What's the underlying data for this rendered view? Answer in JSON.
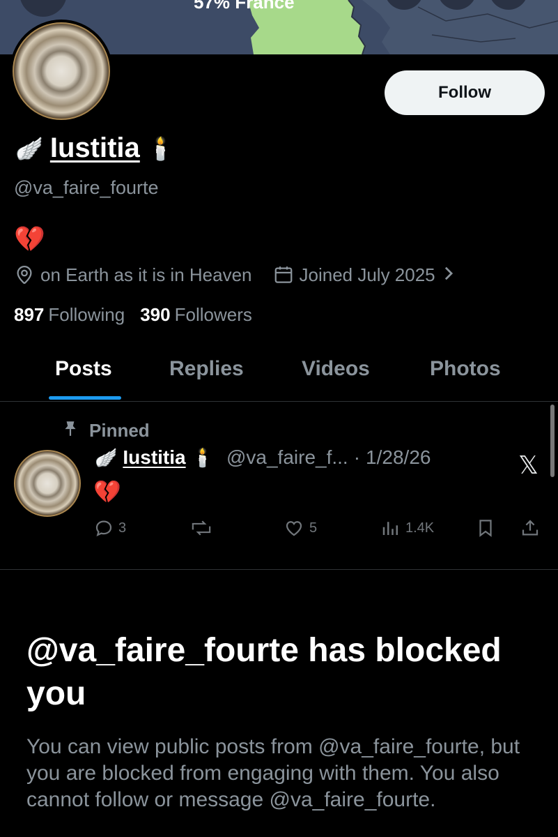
{
  "banner": {
    "text": "57% France"
  },
  "profile": {
    "follow_label": "Follow",
    "name": "Iustitia",
    "name_prefix_emoji": "🪽",
    "name_suffix_emoji": "🕯️",
    "handle": "@va_faire_fourte",
    "bio": "💔",
    "location": "on Earth as it is in Heaven",
    "joined": "Joined July 2025",
    "following_count": "897",
    "following_label": "Following",
    "followers_count": "390",
    "followers_label": "Followers"
  },
  "tabs": [
    {
      "label": "Posts",
      "active": true
    },
    {
      "label": "Replies",
      "active": false
    },
    {
      "label": "Videos",
      "active": false
    },
    {
      "label": "Photos",
      "active": false
    }
  ],
  "post": {
    "pinned_label": "Pinned",
    "name": "Iustitia",
    "handle": "@va_faire_f...",
    "date": "1/28/26",
    "separator": "·",
    "text": "💔",
    "replies": "3",
    "likes": "5",
    "views": "1.4K"
  },
  "blocked": {
    "title": "@va_faire_fourte has blocked you",
    "body": "You can view public posts from @va_faire_fourte, but you are blocked from engaging with them. You also cannot follow or message @va_faire_fourte."
  },
  "colors": {
    "accent": "#1d9bf0",
    "background": "#000000",
    "muted_text": "#8b949c",
    "banner": "#3d4b66",
    "map_green": "#a7d98a"
  }
}
